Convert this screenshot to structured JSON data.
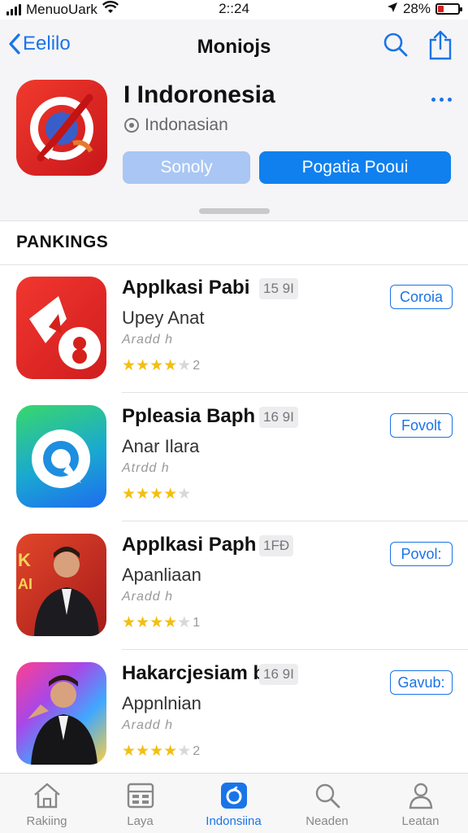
{
  "status_bar": {
    "carrier": "MenuoUark",
    "time": "2::24",
    "battery_percent": "28%",
    "battery_level": 0.28
  },
  "nav": {
    "back_label": "Eelilo",
    "title": "Moniojs"
  },
  "app": {
    "name": "I Indoronesia",
    "subtitle": "Indonasian",
    "secondary_button": "Sonoly",
    "primary_button": "Pogatia Pooui"
  },
  "section": {
    "title": "PANKINGS"
  },
  "rankings": [
    {
      "title": "Applkasi Pabi",
      "badge": "15 9I",
      "subtitle": "Upey Anat",
      "small": "Aradd h",
      "rating": 4,
      "rating_count": "2",
      "button": "Coroia"
    },
    {
      "title": "Ppleasia Baph",
      "badge": "16 9I",
      "subtitle": "Anar Ilara",
      "small": "Atrdd h",
      "rating": 4,
      "rating_count": "",
      "button": "Fovolt"
    },
    {
      "title": "Applkasi Paph",
      "badge": "1FÐ",
      "subtitle": "Apanliaan",
      "small": "Aradd h",
      "rating": 4,
      "rating_count": "1",
      "button": "Povol:"
    },
    {
      "title": "Hakarcjesiam bi",
      "badge": "16 9I",
      "subtitle": "Appnlnian",
      "small": "Aradd h",
      "rating": 4,
      "rating_count": "2",
      "button": "Gavub:"
    }
  ],
  "tabs": [
    {
      "label": "Rakiing",
      "icon": "home-icon"
    },
    {
      "label": "Laya",
      "icon": "grid-layout-icon"
    },
    {
      "label": "Indonsiina",
      "icon": "app-store-icon",
      "active": true
    },
    {
      "label": "Neaden",
      "icon": "search-icon"
    },
    {
      "label": "Leatan",
      "icon": "person-icon"
    }
  ],
  "colors": {
    "accent": "#1a74e8",
    "header_bg": "#f5f5f7",
    "star": "#f3bf11"
  }
}
